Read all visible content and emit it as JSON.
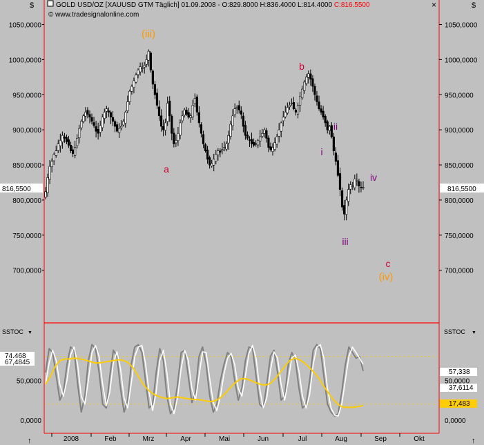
{
  "header": {
    "instrument": "GOLD USD/OZ [XAUUSD GTM  Täglich] 01.09.2008 - O:829.8000 H:836.4000 L:814.4000 ",
    "close_text": "C:816.5500",
    "copyright": "© www.tradesignalonline.com"
  },
  "colors": {
    "background": "#c0c0c0",
    "frame": "#ff0000",
    "candle": "#000000",
    "wave_orange": "#ff9900",
    "wave_red": "#cc0033",
    "wave_purple": "#800080",
    "stoch_k": "#808080",
    "stoch_d": "#ffffff",
    "stoch_slow": "#ffcc00",
    "level": "#ffcc00"
  },
  "chart_data": [
    {
      "type": "candlestick",
      "title": "GOLD USD/OZ",
      "ylim": [
        625,
        1080
      ],
      "y_ticks": [
        "1050,0000",
        "1000,0000",
        "950,0000",
        "900,0000",
        "850,0000",
        "800,0000",
        "750,0000",
        "700,0000"
      ],
      "last_price_label": "816,5500",
      "last_price": 816.55,
      "series": [
        {
          "values": [
            812,
            832,
            848,
            855,
            865,
            870,
            880,
            885,
            892,
            888,
            883,
            878,
            870,
            866,
            875,
            888,
            902,
            912,
            920,
            925,
            922,
            918,
            912,
            906,
            898,
            895,
            906,
            918,
            925,
            930,
            925,
            918,
            912,
            905,
            898,
            902,
            905,
            912,
            925,
            940,
            955,
            962,
            970,
            978,
            985,
            990,
            988,
            992,
            1000,
            1012,
            985,
            965,
            950,
            935,
            920,
            905,
            900,
            910,
            938,
            920,
            895,
            880,
            885,
            895,
            910,
            920,
            928,
            922,
            918,
            920,
            935,
            945,
            925,
            910,
            895,
            880,
            870,
            858,
            850,
            852,
            858,
            865,
            870,
            868,
            872,
            875,
            880,
            892,
            908,
            920,
            930,
            932,
            928,
            922,
            905,
            892,
            888,
            885,
            880,
            878,
            880,
            885,
            890,
            895,
            900,
            888,
            875,
            872,
            875,
            882,
            890,
            900,
            910,
            918,
            925,
            932,
            935,
            938,
            930,
            925,
            935,
            948,
            958,
            968,
            975,
            980,
            972,
            962,
            950,
            940,
            930,
            925,
            918,
            910,
            900,
            905,
            890,
            870,
            855,
            835,
            815,
            790,
            780,
            800,
            815,
            822,
            820,
            830,
            828,
            820,
            818,
            818
          ]
        }
      ],
      "wave_labels": [
        {
          "text": "(iii)",
          "color": "orange"
        },
        {
          "text": "a",
          "color": "red"
        },
        {
          "text": "b",
          "color": "red"
        },
        {
          "text": "i",
          "color": "purple"
        },
        {
          "text": "ii",
          "color": "purple"
        },
        {
          "text": "iii",
          "color": "purple"
        },
        {
          "text": "iv",
          "color": "purple"
        },
        {
          "text": "c",
          "color": "red"
        },
        {
          "text": "(iv)",
          "color": "orange"
        }
      ]
    },
    {
      "type": "line",
      "title": "SSTOC",
      "ylim": [
        -8,
        105
      ],
      "y_ticks": [
        "50,0000",
        "0,0000"
      ],
      "levels": [
        80,
        20
      ],
      "series": [
        {
          "name": "K",
          "values": [
            60,
            90,
            85,
            55,
            25,
            35,
            70,
            92,
            88,
            45,
            10,
            30,
            75,
            95,
            90,
            60,
            20,
            15,
            55,
            88,
            80,
            40,
            10,
            25,
            70,
            92,
            95,
            85,
            50,
            15,
            20,
            60,
            90,
            75,
            30,
            8,
            15,
            45,
            85,
            88,
            55,
            22,
            35,
            80,
            92,
            70,
            30,
            10,
            20,
            50,
            70,
            85,
            80,
            50,
            25,
            40,
            75,
            92,
            90,
            55,
            20,
            15,
            45,
            80,
            88,
            60,
            25,
            30,
            70,
            85,
            75,
            40,
            15,
            20,
            50,
            88,
            95,
            90,
            55,
            20,
            10,
            5,
            8,
            35,
            70,
            92,
            85,
            78,
            80,
            62
          ]
        },
        {
          "name": "D",
          "values": [
            45,
            72,
            88,
            75,
            45,
            30,
            50,
            82,
            92,
            70,
            30,
            20,
            50,
            85,
            94,
            80,
            45,
            18,
            35,
            72,
            86,
            65,
            28,
            15,
            45,
            80,
            92,
            94,
            72,
            35,
            12,
            35,
            75,
            88,
            60,
            20,
            8,
            28,
            65,
            88,
            75,
            40,
            25,
            55,
            86,
            85,
            52,
            22,
            12,
            30,
            58,
            78,
            84,
            70,
            40,
            30,
            55,
            84,
            94,
            78,
            40,
            15,
            28,
            62,
            86,
            78,
            45,
            25,
            50,
            78,
            82,
            62,
            30,
            15,
            32,
            70,
            92,
            95,
            78,
            40,
            15,
            6,
            5,
            20,
            50,
            80,
            92,
            85,
            78,
            70
          ]
        },
        {
          "name": "Slow",
          "values": [
            45,
            55,
            68,
            75,
            77,
            77,
            78,
            77,
            76,
            74,
            72,
            72,
            73,
            74,
            75,
            76,
            75,
            72,
            65,
            55,
            45,
            38,
            33,
            30,
            28,
            27,
            28,
            29,
            28,
            27,
            26,
            26,
            25,
            24,
            23,
            25,
            29,
            35,
            42,
            48,
            52,
            52,
            50,
            47,
            45,
            44,
            46,
            52,
            60,
            68,
            75,
            78,
            76,
            72,
            66,
            60,
            52,
            42,
            33,
            25,
            19,
            16,
            16,
            16,
            17,
            18
          ]
        }
      ],
      "value_labels": [
        "74,468",
        "67,4845",
        "57,338",
        "37,6114",
        "17,483"
      ]
    }
  ],
  "x_axis": {
    "ticks": [
      "2008",
      "Feb",
      "Mrz",
      "Apr",
      "Mai",
      "Jun",
      "Jul",
      "Aug",
      "Sep",
      "Okt"
    ]
  },
  "ui": {
    "price_scale_marker": "$",
    "close_marker": "×",
    "indicator_label": "SSTOC",
    "dropdown_arrow": "▼",
    "scroll_up_arrow": "↑"
  }
}
